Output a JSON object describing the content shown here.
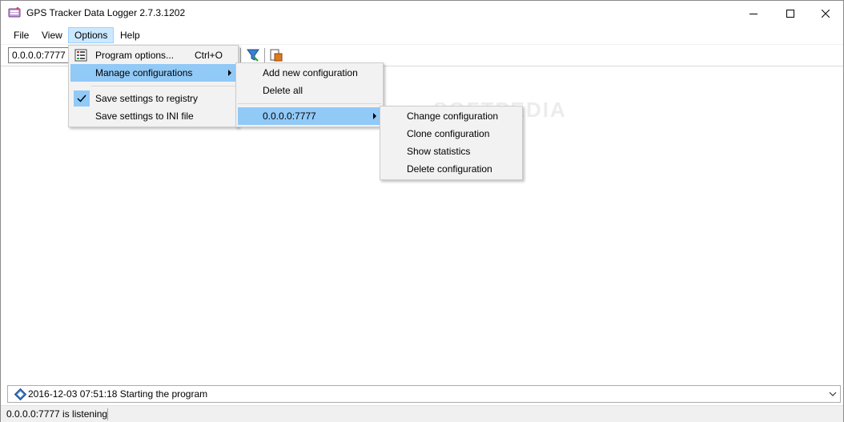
{
  "window": {
    "title": "GPS Tracker Data Logger 2.7.3.1202"
  },
  "menubar": {
    "items": [
      {
        "label": "File"
      },
      {
        "label": "View"
      },
      {
        "label": "Options"
      },
      {
        "label": "Help"
      }
    ]
  },
  "toolbar": {
    "address_value": "0.0.0.0:7777"
  },
  "options_menu": {
    "program_options": "Program options...",
    "program_options_shortcut": "Ctrl+O",
    "manage_configurations": "Manage configurations",
    "save_registry": "Save settings to registry",
    "save_ini": "Save settings to INI file"
  },
  "manage_menu": {
    "add_new": "Add new configuration",
    "delete_all": "Delete all",
    "config_entry": "0.0.0.0:7777"
  },
  "config_menu": {
    "change": "Change configuration",
    "clone": "Clone configuration",
    "show_stats": "Show statistics",
    "delete": "Delete configuration"
  },
  "log": {
    "entry": "2016-12-03 07:51:18 Starting the program"
  },
  "statusbar": {
    "text": "0.0.0.0:7777 is listening"
  },
  "watermark": "SOFTPEDIA",
  "colors": {
    "menu_highlight": "#91c9f7",
    "menubar_active": "#cce8ff",
    "popup_bg": "#f2f2f2"
  }
}
